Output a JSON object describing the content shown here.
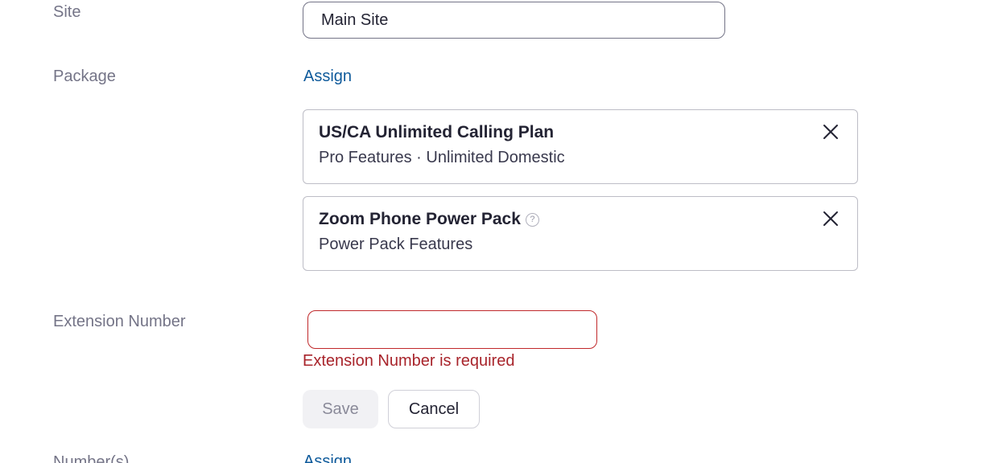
{
  "site": {
    "label": "Site",
    "value": "Main Site"
  },
  "package": {
    "label": "Package",
    "assign_link": "Assign",
    "items": [
      {
        "title": "US/CA Unlimited Calling Plan",
        "subtitle": "Pro Features · Unlimited Domestic",
        "remove_icon": "close-icon"
      },
      {
        "title": "Zoom Phone Power Pack",
        "subtitle": "Power Pack Features",
        "help_icon": "?",
        "remove_icon": "close-icon"
      }
    ]
  },
  "extension": {
    "label": "Extension Number",
    "value": "",
    "error": "Extension Number is required"
  },
  "actions": {
    "save_label": "Save",
    "cancel_label": "Cancel"
  },
  "numbers": {
    "label": "Number(s)",
    "assign_link": "Assign"
  },
  "colors": {
    "link": "#0e5a9b",
    "error": "#a8242b",
    "error_border": "#c0292b",
    "label": "#747487"
  }
}
